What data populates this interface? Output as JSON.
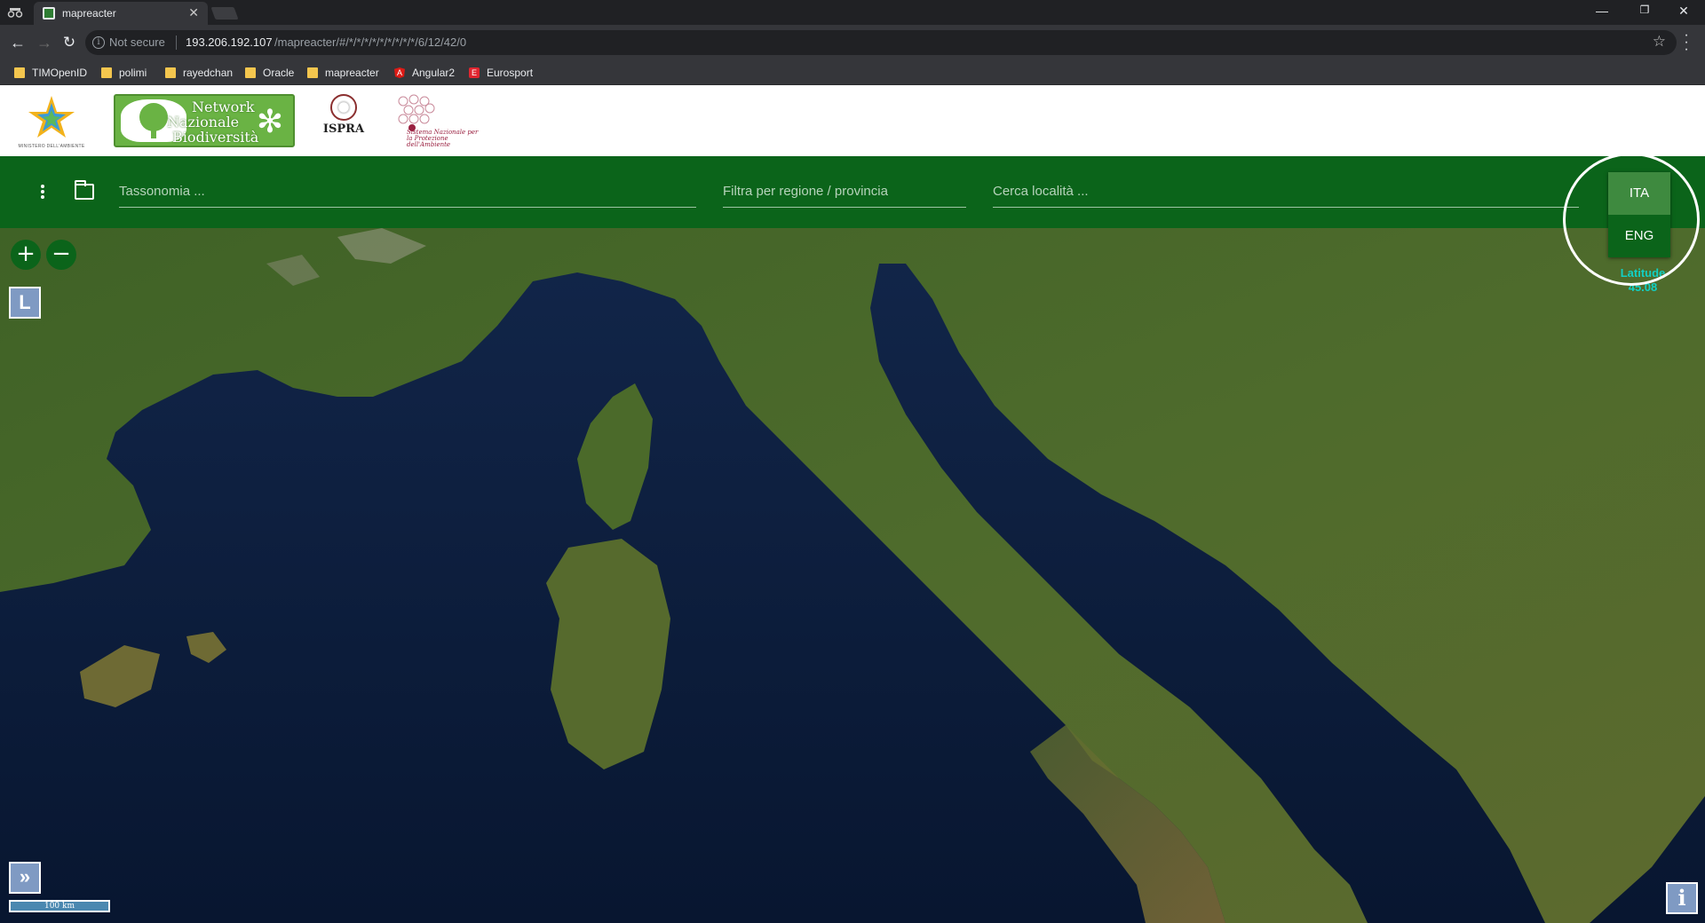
{
  "browser": {
    "tab_title": "mapreacter",
    "tab_close": "✕",
    "url_security": "Not secure",
    "url_host": "193.206.192.107",
    "url_path": "/mapreacter/#/*/*/*/*/*/*/*/*/*/6/12/42/0",
    "window_controls": {
      "minimize": "—",
      "maximize": "❐",
      "close": "✕"
    },
    "nav": {
      "back": "←",
      "forward": "→",
      "reload": "↻",
      "star": "☆",
      "menu": "⋮"
    },
    "bookmarks": [
      {
        "label": "TIMOpenID",
        "icon": "folder-icon"
      },
      {
        "label": "polimi",
        "icon": "folder-icon"
      },
      {
        "label": "rayedchan",
        "icon": "folder-icon"
      },
      {
        "label": "Oracle",
        "icon": "folder-icon"
      },
      {
        "label": "mapreacter",
        "icon": "folder-icon"
      },
      {
        "label": "Angular2",
        "icon": "angular-icon"
      },
      {
        "label": "Eurosport",
        "icon": "eurosport-icon"
      }
    ]
  },
  "header": {
    "nnb_logo_lines": [
      "Network",
      "Nazionale",
      "Biodiversità"
    ],
    "ministero_caption": "MINISTERO DELL'AMBIENTE",
    "ispra_label": "ISPRA",
    "snpa_caption": "Sistema Nazionale per la Protezione dell'Ambiente"
  },
  "search": {
    "taxonomy_placeholder": "Tassonomia ...",
    "region_placeholder": "Filtra per regione / provincia",
    "location_placeholder": "Cerca località ..."
  },
  "language": {
    "options": [
      "ITA",
      "ENG"
    ],
    "selected": "ITA"
  },
  "map": {
    "zoom_in": "+",
    "zoom_out": "−",
    "layers_label": "L",
    "expand_label": "»",
    "info_label": "i",
    "scale_label": "100 km",
    "coordinate_label": "Latitude",
    "coordinate_value": "45.08"
  },
  "colors": {
    "brand_green": "#0b641a",
    "active_lang": "#3e8a3f",
    "coordinate_text": "#12d0c4"
  }
}
